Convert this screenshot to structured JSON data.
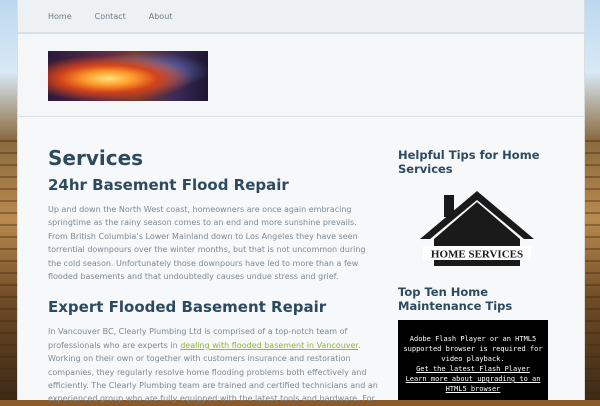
{
  "nav": {
    "items": [
      "Home",
      "Contact",
      "About"
    ]
  },
  "main": {
    "title": "Services",
    "section1": {
      "heading": "24hr Basement Flood Repair",
      "text": "Up and down the North West coast, homeowners are once again embracing springtime as the rainy season comes to an end and more sunshine prevails. From British Columbia’s Lower Mainland down to Los Angeles they have seen torrential downpours over the winter months, but that is not uncommon during the cold season. Unfortunately those downpours have led to more than a few flooded basements and that undoubtedly causes undue stress and grief."
    },
    "section2": {
      "heading": "Expert Flooded Basement Repair",
      "text_before": "In Vancouver BC, Clearly Plumbing Ltd is comprised of a top-notch team of professionals who are experts in ",
      "link": "dealing with flooded basement in Vancouver",
      "text_after": ". Working on their own or together with customers insurance and restoration companies, they regularly resolve home flooding problems both effectively and efficiently. The Clearly Plumbing team are trained and certified technicians and an experienced group who are fully equipped with the latest tools and hardware. For"
    }
  },
  "sidebar": {
    "widget1_title": "Helpful Tips for Home Services",
    "home_services_label": "HOME SERVICES",
    "widget2_title": "Top Ten Home Maintenance Tips",
    "flash": {
      "message": "Adobe Flash Player or an HTML5 supported browser is required for video playback.",
      "link1": "Get the latest Flash Player",
      "link2": "Learn more about upgrading to an HTML5 browser"
    }
  }
}
